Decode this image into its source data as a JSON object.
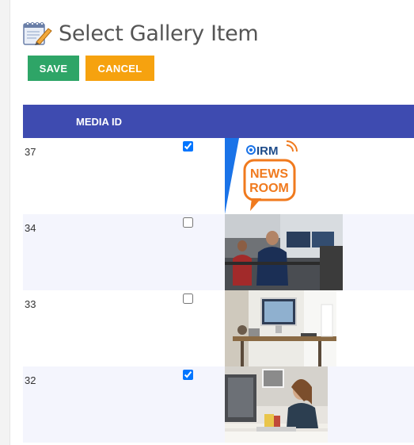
{
  "header": {
    "title": "Select Gallery Item",
    "save_label": "SAVE",
    "cancel_label": "CANCEL"
  },
  "table": {
    "columns": [
      "MEDIA ID"
    ],
    "rows": [
      {
        "id": "37",
        "checked": true,
        "image": "irm-newsroom-logo"
      },
      {
        "id": "34",
        "checked": false,
        "image": "office-workers-photo"
      },
      {
        "id": "33",
        "checked": false,
        "image": "desk-workspace-photo"
      },
      {
        "id": "32",
        "checked": true,
        "image": "woman-at-desk-photo"
      }
    ]
  },
  "logo": {
    "brand": "IRM",
    "line1": "NEWS",
    "line2": "ROOM"
  },
  "colors": {
    "header_bg": "#3e4bb0",
    "save": "#2ea567",
    "cancel": "#f6a20f",
    "row_alt": "#f4f5fd"
  }
}
